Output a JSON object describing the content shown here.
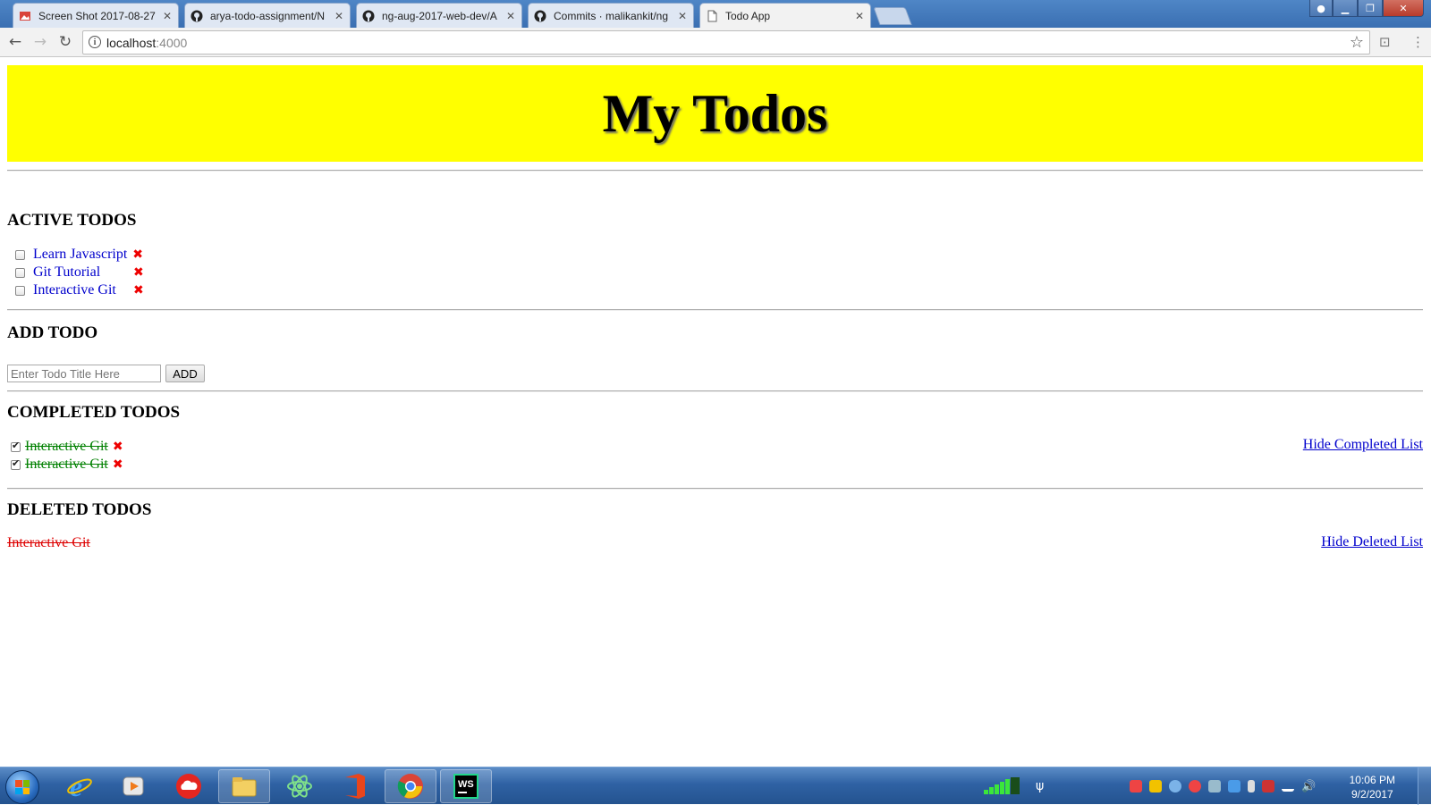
{
  "browser": {
    "tabs": [
      {
        "title": "Screen Shot 2017-08-27",
        "icon": "image-icon",
        "active": false
      },
      {
        "title": "arya-todo-assignment/N",
        "icon": "github-icon",
        "active": false
      },
      {
        "title": "ng-aug-2017-web-dev/A",
        "icon": "github-icon",
        "active": false
      },
      {
        "title": "Commits · malikankit/ng",
        "icon": "github-icon",
        "active": false
      },
      {
        "title": "Todo App",
        "icon": "page-icon",
        "active": true
      }
    ],
    "close_glyph": "✕",
    "address": {
      "host": "localhost",
      "port": ":4000"
    }
  },
  "page": {
    "title": "My Todos",
    "active_section": {
      "heading": "ACTIVE TODOS",
      "items": [
        {
          "text": "Learn Javascript",
          "checked": false
        },
        {
          "text": "Git Tutorial",
          "checked": false
        },
        {
          "text": "Interactive Git",
          "checked": false
        }
      ]
    },
    "add_section": {
      "heading": "ADD TODO",
      "input_placeholder": "Enter Todo Title Here",
      "button_label": "ADD"
    },
    "completed_section": {
      "heading": "COMPLETED TODOS",
      "toggle_link": "Hide Completed List",
      "items": [
        {
          "text": "Interactive Git",
          "checked": true
        },
        {
          "text": "Interactive Git",
          "checked": true
        }
      ]
    },
    "deleted_section": {
      "heading": "DELETED TODOS",
      "toggle_link": "Hide Deleted List",
      "items": [
        {
          "text": "Interactive Git"
        }
      ]
    },
    "delete_glyph": "✖"
  },
  "taskbar": {
    "apps": [
      "internet-explorer-icon",
      "media-player-icon",
      "cloud-app-icon",
      "file-explorer-icon",
      "atom-editor-icon",
      "office-icon",
      "chrome-icon",
      "webstorm-icon"
    ],
    "clock": {
      "time": "10:06 PM",
      "date": "9/2/2017"
    }
  },
  "colors": {
    "banner": "#ffff00",
    "active_todo": "#0000cc",
    "completed_todo": "#008000",
    "deleted_todo": "#dd0000"
  }
}
